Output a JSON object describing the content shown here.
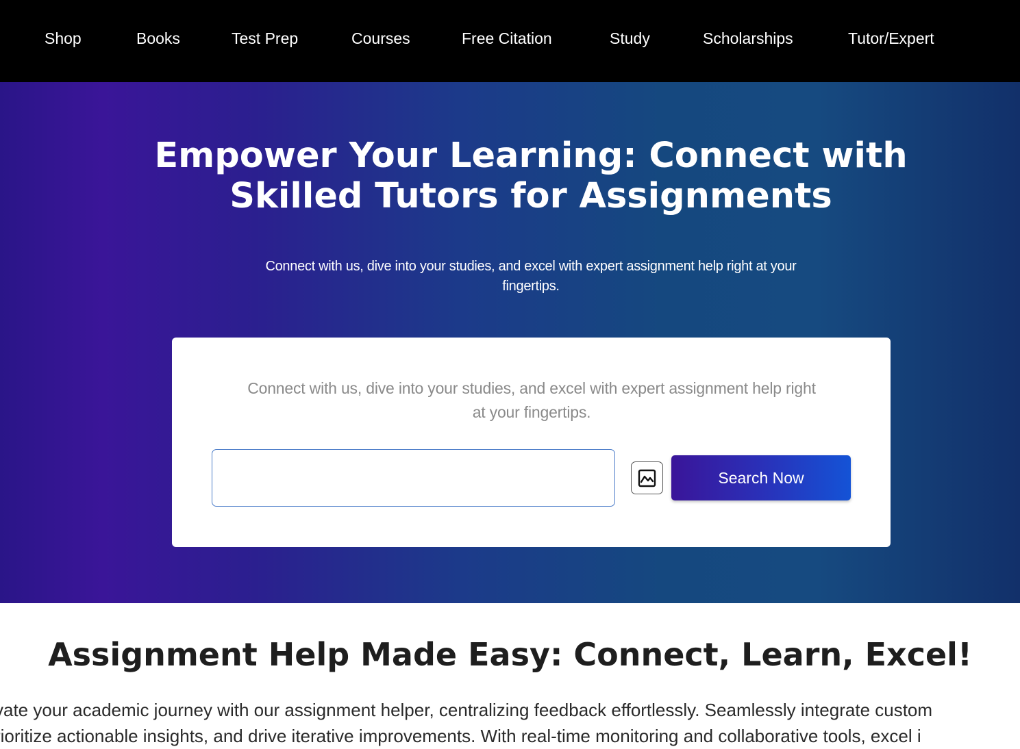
{
  "nav": {
    "items": [
      {
        "label": "Shop"
      },
      {
        "label": "Books"
      },
      {
        "label": "Test Prep"
      },
      {
        "label": "Courses"
      },
      {
        "label": "Free Citation"
      },
      {
        "label": "Study"
      },
      {
        "label": "Scholarships"
      },
      {
        "label": "Tutor/Expert"
      }
    ]
  },
  "hero": {
    "title": "Empower Your Learning: Connect with Skilled Tutors for Assignments",
    "subtitle": "Connect with us, dive into your studies, and excel with expert assignment help right at your fingertips.",
    "card": {
      "description": "Connect with us, dive into your studies, and excel with expert assignment help right at your fingertips.",
      "input_value": "",
      "image_button_icon": "image-icon",
      "search_button_label": "Search Now"
    }
  },
  "section": {
    "title": "Assignment Help Made Easy: Connect, Learn, Excel!",
    "body_line_1": "vate your academic journey with our assignment helper, centralizing feedback effortlessly. Seamlessly integrate custom",
    "body_line_2": "rioritize actionable insights, and drive iterative improvements. With real-time monitoring and collaborative tools, excel i"
  },
  "colors": {
    "nav_background": "#000000",
    "hero_gradient_start": "#2a1588",
    "hero_gradient_end": "#12306a",
    "search_button_start": "#3a1599",
    "search_button_end": "#1453d6",
    "input_border": "#4a7bc8"
  }
}
